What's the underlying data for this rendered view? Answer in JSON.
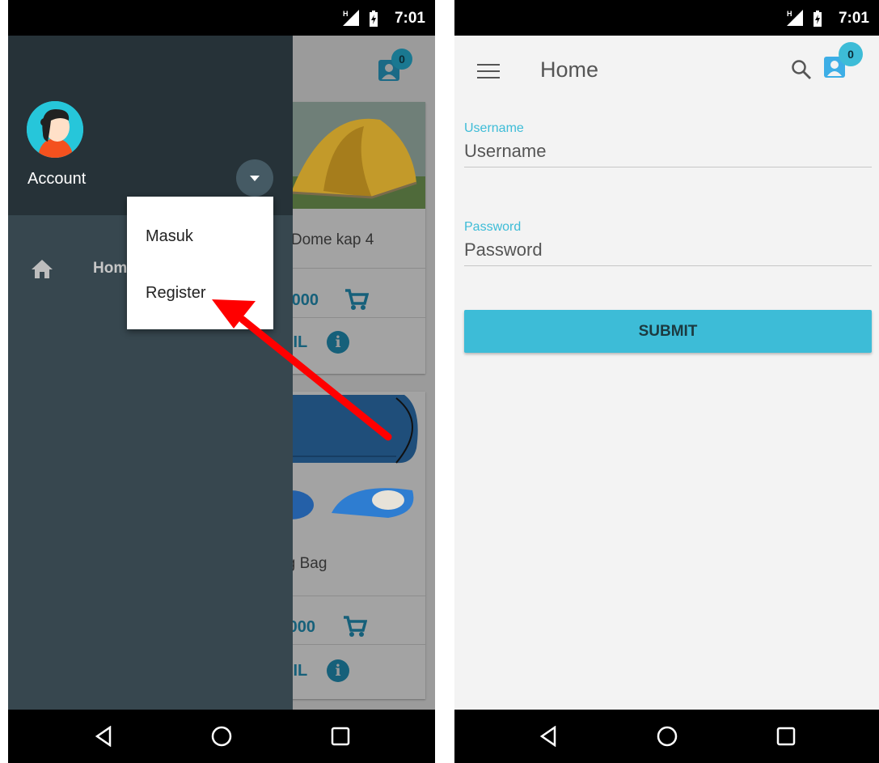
{
  "status_bar": {
    "time": "7:01"
  },
  "left_screen": {
    "drawer": {
      "account_label": "Account",
      "nav_items": [
        {
          "label": "Home",
          "icon": "home-icon"
        }
      ],
      "account_menu": [
        {
          "label": "Masuk"
        },
        {
          "label": "Register"
        }
      ]
    },
    "background_products": [
      {
        "name": "n Dome kap 4",
        "price": "0,000",
        "detail_label": "AIL"
      },
      {
        "name": "ing Bag",
        "price": "0,000",
        "detail_label": "AIL"
      }
    ],
    "cart_count": "0"
  },
  "right_screen": {
    "title": "Home",
    "cart_count": "0",
    "form": {
      "username": {
        "label": "Username",
        "placeholder": "Username"
      },
      "password": {
        "label": "Password",
        "placeholder": "Password"
      },
      "submit_label": "SUBMIT"
    }
  },
  "colors": {
    "accent": "#3dbcd7",
    "drawer_header": "#263238",
    "drawer_body": "#37474f",
    "annotation_arrow": "#ff0000"
  }
}
